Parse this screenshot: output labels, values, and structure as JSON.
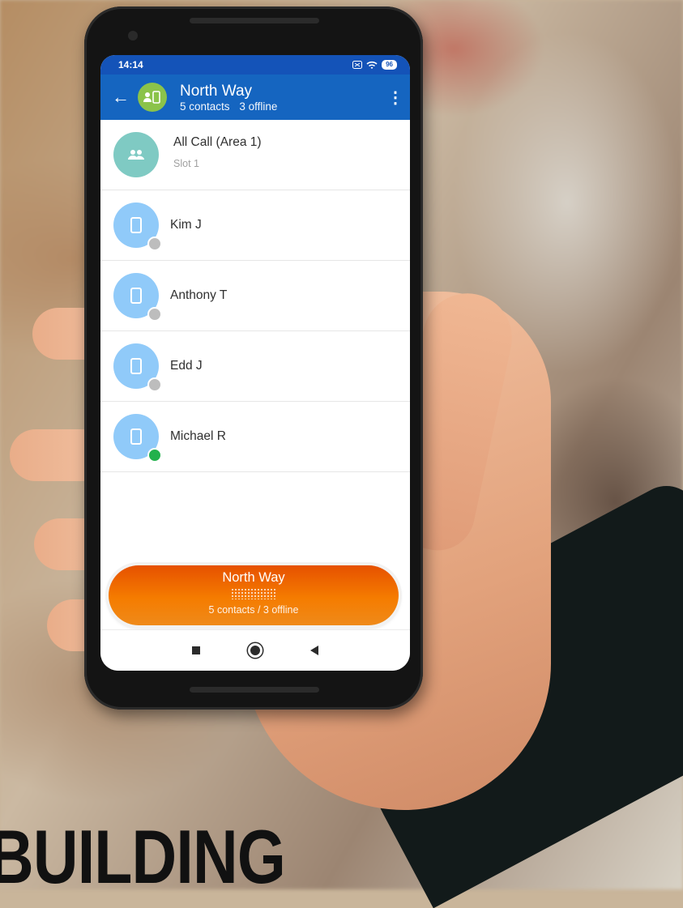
{
  "status_bar": {
    "time": "14:14",
    "battery": "96"
  },
  "header": {
    "title": "North Way",
    "contacts": "5 contacts",
    "offline": "3 offline"
  },
  "contacts": [
    {
      "name": "All Call (Area 1)",
      "sub": "Slot 1",
      "type": "group",
      "status": "none"
    },
    {
      "name": "Kim J",
      "type": "device",
      "status": "offline"
    },
    {
      "name": "Anthony T",
      "type": "device",
      "status": "offline"
    },
    {
      "name": "Edd J",
      "type": "device",
      "status": "offline"
    },
    {
      "name": "Michael R",
      "type": "device",
      "status": "online"
    }
  ],
  "ptt": {
    "title": "North Way",
    "subtitle": "5 contacts / 3 offline"
  },
  "headline": "BUILDING",
  "colors": {
    "app_bar": "#1565c0",
    "status_bar": "#1453b8",
    "group_avatar": "#8bc34a",
    "device_avatar": "#90caf9",
    "ptt_button": "#f57c00",
    "online": "#22b14c",
    "offline": "#bdbdbd"
  }
}
